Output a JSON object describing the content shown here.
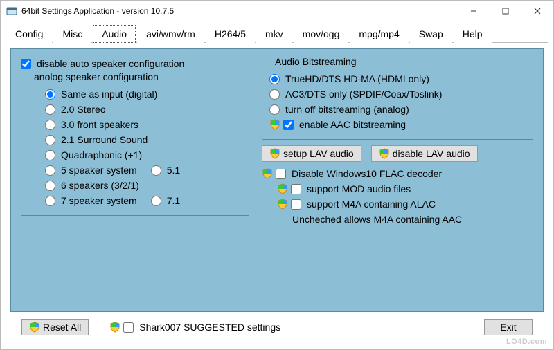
{
  "window": {
    "title": "64bit Settings Application - version 10.7.5",
    "min": "—",
    "max": "☐",
    "close": "✕"
  },
  "tabs": [
    "Config",
    "Misc",
    "Audio",
    "avi/wmv/rm",
    "H264/5",
    "mkv",
    "mov/ogg",
    "mpg/mp4",
    "Swap",
    "Help"
  ],
  "active_tab": 2,
  "left": {
    "disable_auto": "disable auto speaker configuration",
    "group": "anolog speaker configuration",
    "options": [
      "Same as input (digital)",
      "2.0 Stereo",
      "3.0 front speakers",
      "2.1 Surround Sound",
      "Quadraphonic (+1)",
      "5 speaker system",
      "6 speakers (3/2/1)",
      "7 speaker system"
    ],
    "side51": "5.1",
    "side71": "7.1"
  },
  "right": {
    "group": "Audio Bitstreaming",
    "bs_options": [
      "TrueHD/DTS HD-MA (HDMI only)",
      "AC3/DTS only (SPDIF/Coax/Toslink)",
      "turn off bitstreaming (analog)"
    ],
    "enable_aac": "enable AAC bitstreaming",
    "setup_lav": "setup LAV audio",
    "disable_lav": "disable LAV audio",
    "flac": "Disable Windows10 FLAC decoder",
    "mod": "support MOD audio files",
    "m4a": "support M4A containing ALAC",
    "note": "Uncheched allows M4A containing AAC"
  },
  "bottom": {
    "reset": "Reset All",
    "suggested": "Shark007 SUGGESTED settings",
    "exit": "Exit"
  },
  "watermark": "LO4D.com"
}
